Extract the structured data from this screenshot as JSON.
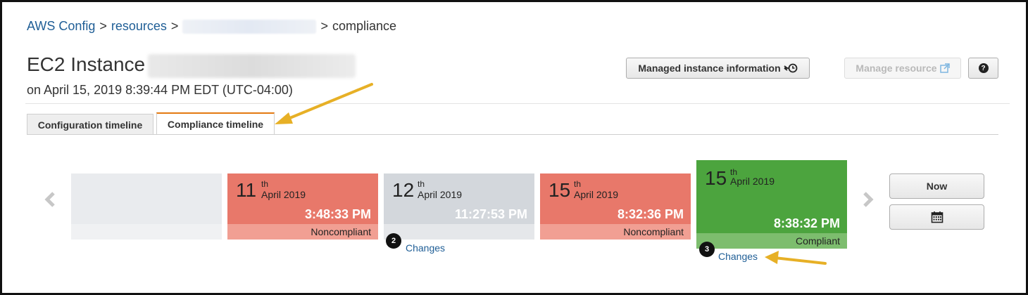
{
  "breadcrumb": {
    "aws_config": "AWS Config",
    "sep1": ">",
    "resources": "resources",
    "sep2": ">",
    "sep3": ">",
    "compliance": "compliance"
  },
  "header": {
    "title": "EC2 Instance",
    "subtitle": "on April 15, 2019 8:39:44 PM EDT (UTC-04:00)"
  },
  "buttons": {
    "managed_instance": "Managed instance information",
    "manage_resource": "Manage resource",
    "help": "?"
  },
  "tabs": [
    {
      "label": "Configuration timeline",
      "active": false
    },
    {
      "label": "Compliance timeline",
      "active": true
    }
  ],
  "timeline": {
    "tiles": [
      {
        "day": "",
        "sup": "",
        "month": "",
        "time": "",
        "status": ""
      },
      {
        "day": "11",
        "sup": "th",
        "month": "April 2019",
        "time": "3:48:33 PM",
        "status": "Noncompliant",
        "color": "#e8786a",
        "status_color": "#f19f93"
      },
      {
        "day": "12",
        "sup": "th",
        "month": "April 2019",
        "time": "11:27:53 PM",
        "status": "",
        "color": "#d3d7dc",
        "status_color": "#e5e7ea",
        "badge": "2",
        "changes": "Changes"
      },
      {
        "day": "15",
        "sup": "th",
        "month": "April 2019",
        "time": "8:32:36 PM",
        "status": "Noncompliant",
        "color": "#e8786a",
        "status_color": "#f19f93"
      },
      {
        "day": "15",
        "sup": "th",
        "month": "April 2019",
        "time": "8:38:32 PM",
        "status": "Compliant",
        "color": "#4ca43e",
        "status_color": "#7dbd6e",
        "badge": "3",
        "changes": "Changes"
      }
    ],
    "now_label": "Now"
  },
  "icons": {
    "history": "history-icon",
    "external_link": "external-link-icon",
    "calendar": "calendar-icon",
    "prev": "chevron-left-icon",
    "next": "chevron-right-icon"
  }
}
